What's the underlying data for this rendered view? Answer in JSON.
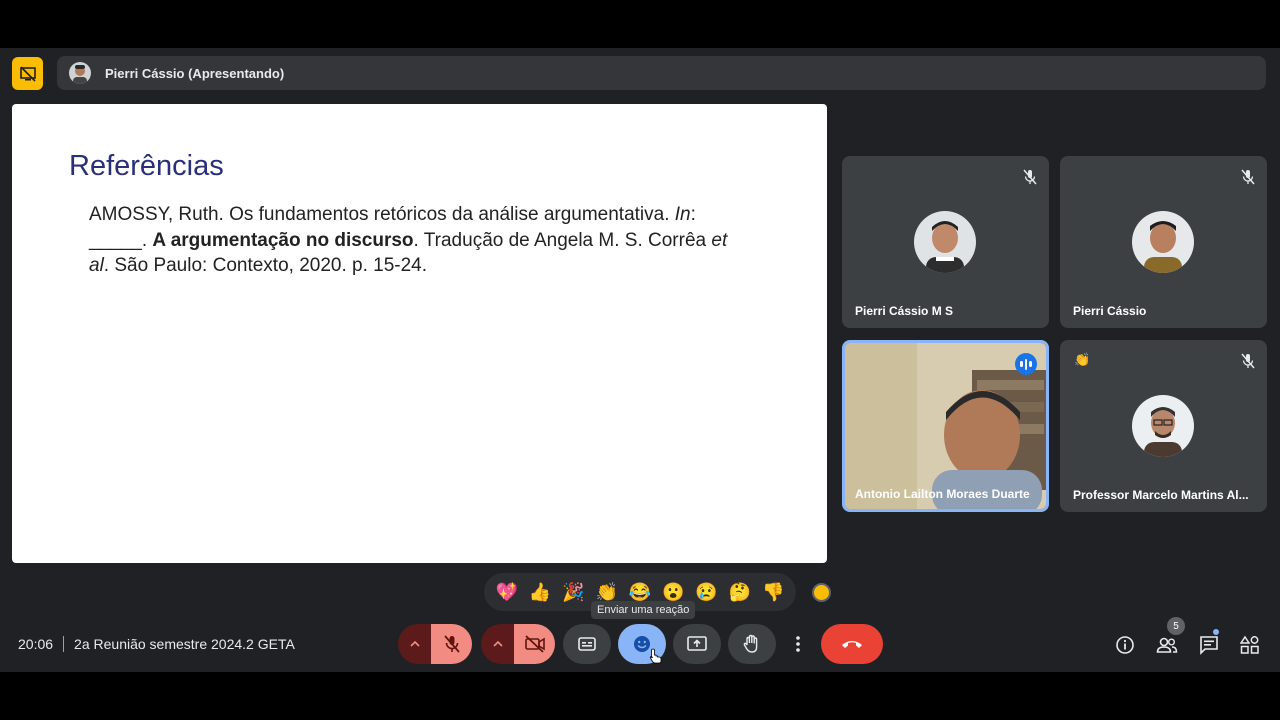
{
  "presenter": {
    "label": "Pierri Cássio (Apresentando)"
  },
  "slide": {
    "title": "Referências",
    "ref_part1": "AMOSSY, Ruth. Os fundamentos retóricos da análise argumentativa. ",
    "ref_in": "In",
    "ref_colon": ": ",
    "ref_blank": "_____",
    "ref_dot": ". ",
    "ref_book": "A argumentação no discurso",
    "ref_part2": ". Tradução de Angela M. S. Corrêa ",
    "ref_etal": "et al",
    "ref_part3": ". São Paulo: Contexto, 2020. p. 15-24."
  },
  "participants": [
    {
      "name": "Pierri Cássio M S",
      "muted": true
    },
    {
      "name": "Pierri Cássio",
      "muted": true
    },
    {
      "name": "Antonio Lailton Moraes Duarte",
      "speaking": true
    },
    {
      "name": "Professor Marcelo Martins Al...",
      "muted": true,
      "reaction": "👏"
    }
  ],
  "reactions": [
    "💖",
    "👍",
    "🎉",
    "👏",
    "😂",
    "😮",
    "😢",
    "🤔",
    "👎"
  ],
  "tooltip": "Enviar uma reação",
  "meeting": {
    "time": "20:06",
    "title": "2a Reunião semestre 2024.2 GETA"
  },
  "people_count": "5",
  "colors": {
    "accent": "#8ab4f8",
    "end_call": "#ea4335",
    "present": "#fbbc04",
    "stage": "#202124"
  }
}
